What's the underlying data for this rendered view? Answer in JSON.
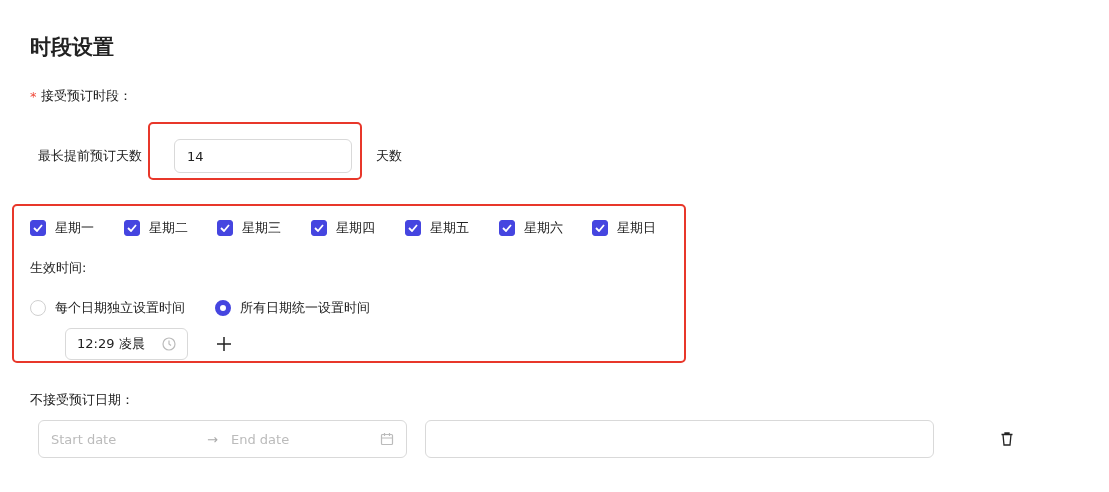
{
  "title": "时段设置",
  "booking_period": {
    "label": "接受预订时段：",
    "required_mark": "*"
  },
  "max_days": {
    "label": "最长提前预订天数",
    "value": "14",
    "unit": "天数"
  },
  "weekdays": [
    {
      "label": "星期一",
      "checked": true
    },
    {
      "label": "星期二",
      "checked": true
    },
    {
      "label": "星期三",
      "checked": true
    },
    {
      "label": "星期四",
      "checked": true
    },
    {
      "label": "星期五",
      "checked": true
    },
    {
      "label": "星期六",
      "checked": true
    },
    {
      "label": "星期日",
      "checked": true
    }
  ],
  "effective_time": {
    "label": "生效时间:",
    "options": [
      {
        "label": "每个日期独立设置时间",
        "selected": false
      },
      {
        "label": "所有日期统一设置时间",
        "selected": true
      }
    ],
    "time_value": "12:29 凌晨"
  },
  "blackout": {
    "label": "不接受预订日期：",
    "start_placeholder": "Start date",
    "separator": "→",
    "end_placeholder": "End date"
  }
}
